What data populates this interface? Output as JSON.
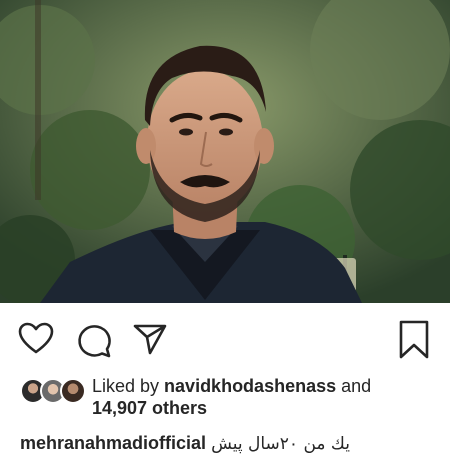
{
  "post": {
    "photo_alt": "",
    "actions": {
      "like_icon": "heart-outline",
      "comment_icon": "speech-bubble-outline",
      "share_icon": "paper-plane-outline",
      "save_icon": "bookmark-outline"
    },
    "likes": {
      "prefix": "Liked by ",
      "top_liker": "navidkhodashenass",
      "joiner": " and",
      "others": "14,907 others"
    },
    "caption": {
      "username": "mehranahmadiofficial",
      "text": "يك من ٢٠سال پيش"
    }
  }
}
